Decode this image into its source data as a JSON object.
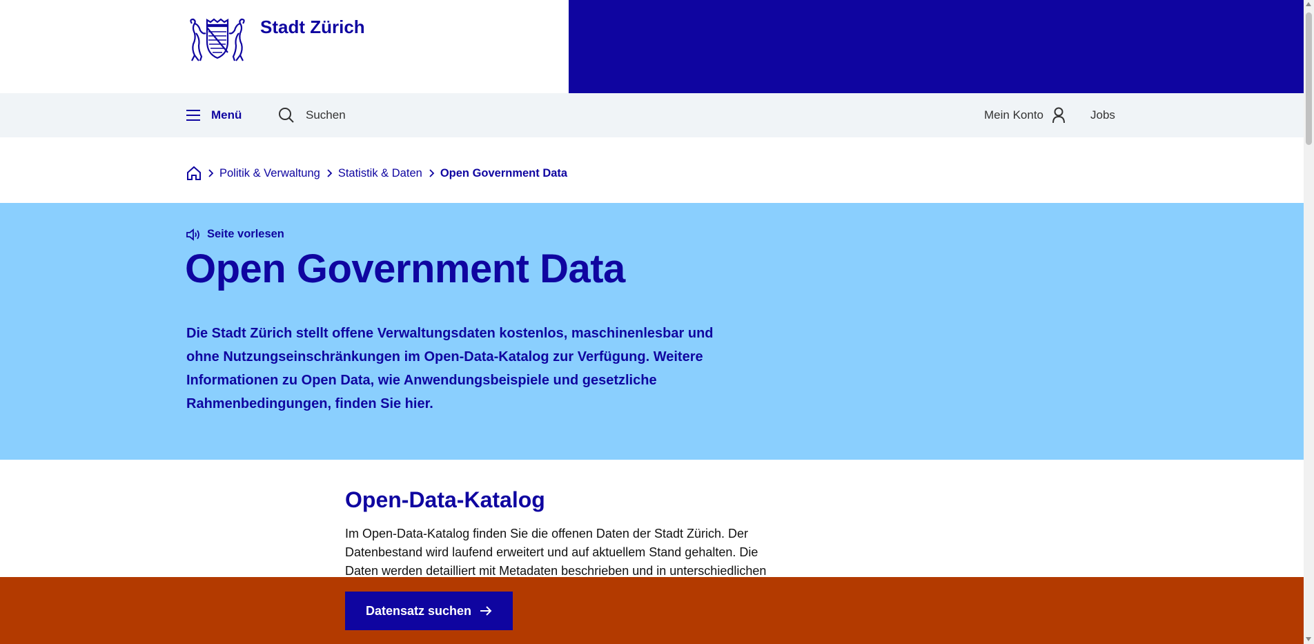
{
  "header": {
    "brand_name": "Stadt Zürich",
    "brand_color": "#0f05a0"
  },
  "nav": {
    "menu_label": "Menü",
    "search_label": "Suchen",
    "account_label": "Mein Konto",
    "jobs_label": "Jobs"
  },
  "breadcrumb": {
    "items": [
      "Politik & Verwaltung",
      "Statistik & Daten"
    ],
    "current": "Open Government Data"
  },
  "hero": {
    "read_aloud_label": "Seite vorlesen",
    "title": "Open Government Data",
    "lead": "Die Stadt Zürich stellt offene Verwaltungsdaten kostenlos, maschinenlesbar und ohne Nutzungseinschränkungen im Open-Data-Katalog zur Verfügung. Weitere Informationen zu Open Data, wie Anwendungsbeispiele und gesetzliche Rahmenbedingungen, finden Sie hier.",
    "background_color": "#8acffe"
  },
  "content": {
    "section_title": "Open-Data-Katalog",
    "section_text": "Im Open-Data-Katalog finden Sie die offenen Daten der Stadt Zürich. Der Datenbestand wird laufend erweitert und auf aktuellem Stand gehalten. Die Daten werden detailliert mit Metadaten beschrieben und in unterschiedlichen"
  },
  "sticky_bar": {
    "cta_label": "Datensatz suchen",
    "background_color": "#b33a00"
  },
  "icons": {
    "logo": "zurich-coat-of-arms",
    "menu": "hamburger-icon",
    "search": "search-icon",
    "account": "user-icon",
    "home": "home-icon",
    "chevron": "chevron-right-icon",
    "speaker": "speaker-icon",
    "arrow": "arrow-right-icon"
  }
}
